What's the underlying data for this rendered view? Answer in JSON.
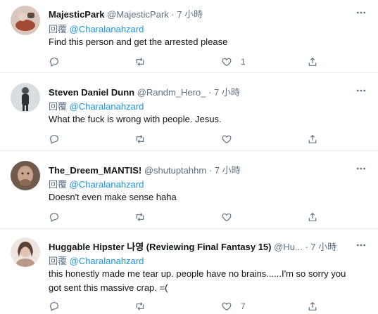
{
  "reply_prefix": "回覆",
  "tweets": [
    {
      "name": "MajesticPark",
      "handle": "@MajesticPark",
      "time": "7 小時",
      "reply_to": "@Charalanahzard",
      "lines": [
        "Find this person and get the arrested please"
      ],
      "likes": "1",
      "avatar_colors": [
        "#c7b3a8",
        "#8a3b2e"
      ]
    },
    {
      "name": "Steven Daniel Dunn",
      "handle": "@Randm_Hero_",
      "time": "7 小時",
      "reply_to": "@Charalanahzard",
      "lines": [
        "What the fuck is wrong with people. Jesus."
      ],
      "likes": "",
      "avatar_colors": [
        "#d4d8dc",
        "#3a3e44"
      ]
    },
    {
      "name": "The_Dreem_MANTIS!",
      "handle": "@shutuptahhm",
      "time": "7 小時",
      "reply_to": "@Charalanahzard",
      "lines": [
        "Doesn't even make sense haha"
      ],
      "likes": "",
      "avatar_colors": [
        "#b79a86",
        "#4a3a30"
      ]
    },
    {
      "name": "Huggable Hipster 나영 (Reviewing Final Fantasy 15)",
      "handle": "@Hu...",
      "time": "7 小時",
      "reply_to": "@Charalanahzard",
      "lines": [
        "this honestly made me tear up. people have no brains......I'm so sorry you",
        "got sent this massive crap. =("
      ],
      "likes": "7",
      "avatar_colors": [
        "#e9dad3",
        "#7b5f52"
      ]
    }
  ],
  "icons": {
    "reply": "reply-icon",
    "retweet": "retweet-icon",
    "like": "like-icon",
    "share": "share-icon",
    "more": "more-icon"
  }
}
